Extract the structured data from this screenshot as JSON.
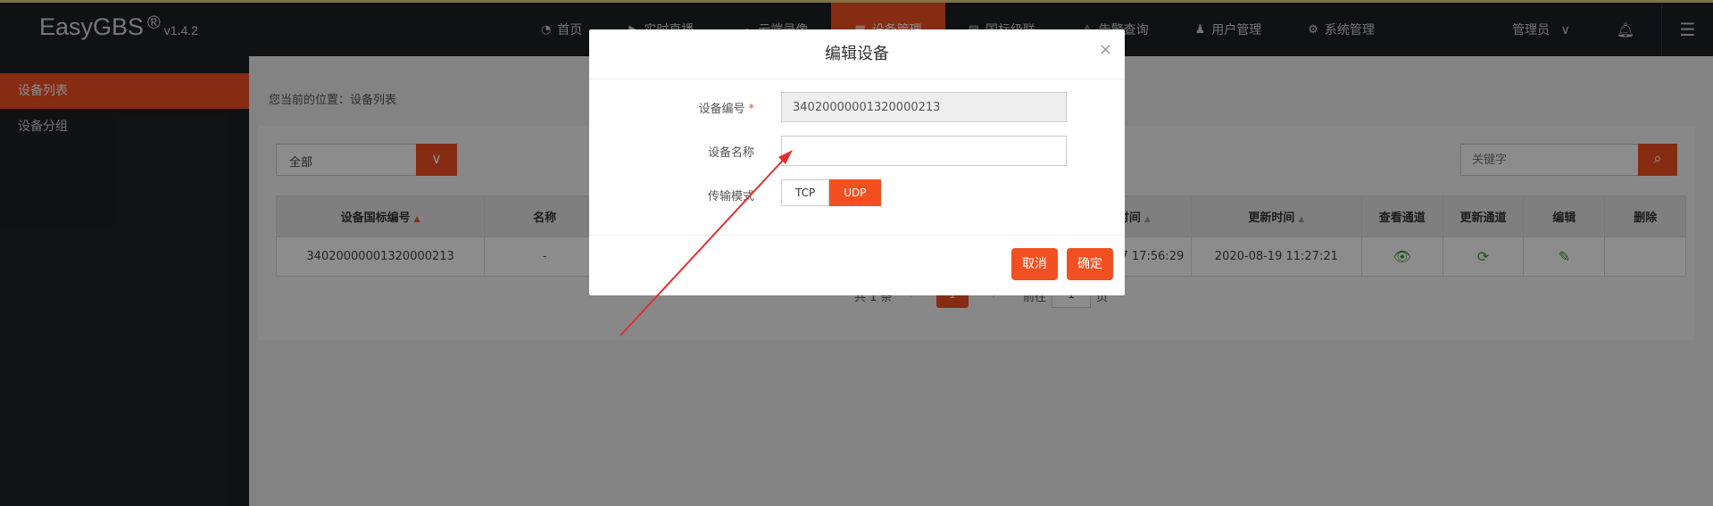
{
  "brand": {
    "name": "EasyGBS",
    "reg": "®",
    "version": "v1.4.2"
  },
  "nav": [
    {
      "icon": "gauge-icon",
      "glyph": "◔",
      "label": "首页"
    },
    {
      "icon": "video-icon",
      "glyph": "▶",
      "label": "实时直播"
    },
    {
      "icon": "cloud-icon",
      "glyph": "☁",
      "label": "云端录像"
    },
    {
      "icon": "device-icon",
      "glyph": "▦",
      "label": "设备管理"
    },
    {
      "icon": "cascade-icon",
      "glyph": "▤",
      "label": "国标级联"
    },
    {
      "icon": "alarm-icon",
      "glyph": "⚠",
      "label": "告警查询"
    },
    {
      "icon": "user-icon",
      "glyph": "♟",
      "label": "用户管理"
    },
    {
      "icon": "gear-icon",
      "glyph": "⚙",
      "label": "系统管理"
    }
  ],
  "user": {
    "name": "管理员",
    "caret": "∨"
  },
  "sidebar": {
    "items": [
      {
        "label": "设备列表"
      },
      {
        "label": "设备分组"
      }
    ]
  },
  "breadcrumb": "您当前的位置：设备列表",
  "filter": {
    "value": "全部",
    "caret": "∨"
  },
  "search": {
    "placeholder": "关键字",
    "glyph": "⌕"
  },
  "table": {
    "headers": [
      "设备国标编号",
      "名称",
      "",
      "",
      "",
      "",
      "创建时间",
      "更新时间",
      "查看通道",
      "更新通道",
      "编辑",
      "删除"
    ],
    "rows": [
      {
        "id": "34020000001320000213",
        "name": "-",
        "created": "2020-08-17 17:56:29",
        "updated": "2020-08-19 11:27:21"
      }
    ]
  },
  "pager": {
    "total": "共 1 条",
    "prev": "‹",
    "page": "1",
    "next": "›",
    "goto_label": "前往",
    "goto_value": "1",
    "unit": "页"
  },
  "modal": {
    "title": "编辑设备",
    "close": "×",
    "fields": {
      "device_id_label": "设备编号",
      "device_id_required": "*",
      "device_id_value": "34020000001320000213",
      "device_name_label": "设备名称",
      "device_name_value": "",
      "transport_label": "传输模式",
      "transport_options": [
        "TCP",
        "UDP"
      ],
      "transport_selected": "UDP"
    },
    "cancel": "取消",
    "confirm": "确定"
  },
  "colors": {
    "accent": "#f25021",
    "annotation": "#e03030"
  }
}
